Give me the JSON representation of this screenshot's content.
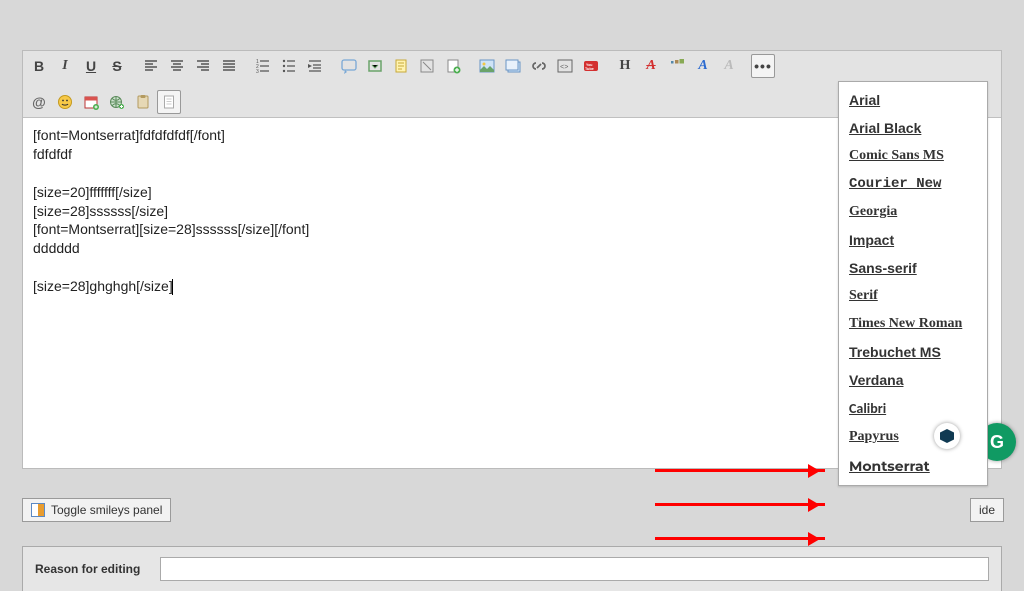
{
  "editorText": {
    "line1": "[font=Montserrat]fdfdfdfdf[/font]",
    "line2": "fdfdfdf",
    "line3": "",
    "line4": "[size=20]fffffff[/size]",
    "line5": "[size=28]ssssss[/size]",
    "line6": "[font=Montserrat][size=28]ssssss[/size][/font]",
    "line7": "dddddd",
    "line8": "",
    "line9": "[size=28]ghghgh[/size]"
  },
  "toolbar": {
    "bold": "B",
    "italic": "I",
    "underline": "U",
    "strike": "S",
    "header": "H",
    "fontItalic": "A",
    "fontColor": "A"
  },
  "fonts": [
    {
      "label": "Arial",
      "family": "Arial, sans-serif"
    },
    {
      "label": "Arial Black",
      "family": "'Arial Black', sans-serif"
    },
    {
      "label": "Comic Sans MS",
      "family": "'Comic Sans MS', cursive"
    },
    {
      "label": "Courier New",
      "family": "'Courier New', monospace"
    },
    {
      "label": "Georgia",
      "family": "Georgia, serif"
    },
    {
      "label": "Impact",
      "family": "Impact, sans-serif"
    },
    {
      "label": "Sans-serif",
      "family": "sans-serif"
    },
    {
      "label": "Serif",
      "family": "serif"
    },
    {
      "label": "Times New Roman",
      "family": "'Times New Roman', serif"
    },
    {
      "label": "Trebuchet MS",
      "family": "'Trebuchet MS', sans-serif"
    },
    {
      "label": "Verdana",
      "family": "Verdana, sans-serif"
    },
    {
      "label": "Calibri",
      "family": "Calibri, sans-serif"
    },
    {
      "label": "Papyrus",
      "family": "Papyrus, fantasy"
    },
    {
      "label": "Montserrat",
      "family": "Montserrat, sans-serif"
    }
  ],
  "panel": {
    "toggleSmileys": "Toggle smileys panel",
    "hide": "ide"
  },
  "reason": {
    "label": "Reason for editing",
    "value": ""
  },
  "fab": {
    "g": "G"
  }
}
